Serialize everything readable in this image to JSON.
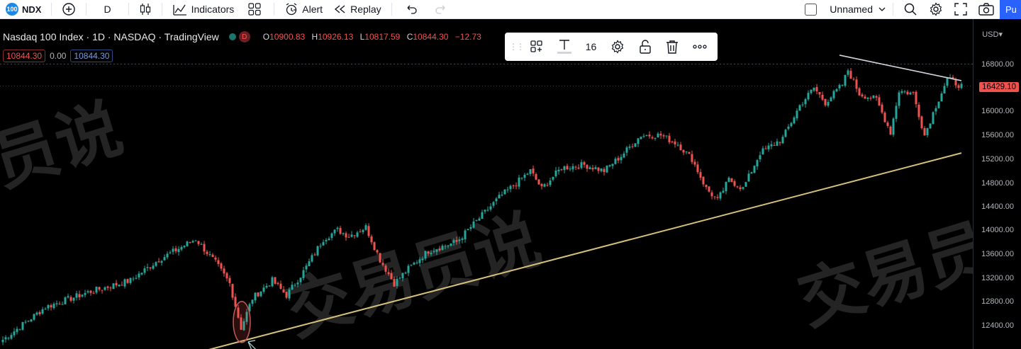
{
  "toolbar": {
    "symbol": "NDX",
    "symbol_logo": "100",
    "interval": "D",
    "indicators_label": "Indicators",
    "alert_label": "Alert",
    "replay_label": "Replay",
    "layout_name": "Unnamed",
    "publish_label": "Pu"
  },
  "legend": {
    "title": "Nasdaq 100 Index · 1D · NASDAQ · TradingView",
    "badge": "D",
    "ohlc": [
      {
        "key": "O",
        "value": "10900.83"
      },
      {
        "key": "H",
        "value": "10926.13"
      },
      {
        "key": "L",
        "value": "10817.59"
      },
      {
        "key": "C",
        "value": "10844.30"
      },
      {
        "key": "",
        "value": "−12.73"
      }
    ],
    "bid": "10844.30",
    "spread": "0.00",
    "ask": "10844.30"
  },
  "drawing_toolbar": {
    "font_size": "16"
  },
  "price_axis": {
    "currency": "USD",
    "ticks": [
      "16800.00",
      "16400.00",
      "16000.00",
      "15600.00",
      "15200.00",
      "14800.00",
      "14400.00",
      "14000.00",
      "13600.00",
      "13200.00",
      "12800.00",
      "12400.00"
    ],
    "last_price": "16429.10"
  },
  "watermark": {
    "text": "交易员说"
  },
  "colors": {
    "up": "#26a69a",
    "down": "#ef5350",
    "trendline": "#d4c07a",
    "accent": "#2962ff"
  },
  "chart_data": {
    "type": "candlestick",
    "symbol": "NDX",
    "interval": "1D",
    "ylim": [
      12000,
      17200
    ],
    "y_ticks": [
      12400,
      12800,
      13200,
      13600,
      14000,
      14400,
      14800,
      15200,
      15600,
      16000,
      16400,
      16800
    ],
    "path_keypoints": [
      {
        "i": 0,
        "price": 12150
      },
      {
        "i": 15,
        "price": 12700
      },
      {
        "i": 30,
        "price": 12950
      },
      {
        "i": 45,
        "price": 13150
      },
      {
        "i": 55,
        "price": 13500
      },
      {
        "i": 68,
        "price": 13850
      },
      {
        "i": 75,
        "price": 13450
      },
      {
        "i": 80,
        "price": 13100
      },
      {
        "i": 84,
        "price": 12350
      },
      {
        "i": 88,
        "price": 12850
      },
      {
        "i": 95,
        "price": 13150
      },
      {
        "i": 100,
        "price": 12900
      },
      {
        "i": 106,
        "price": 13300
      },
      {
        "i": 113,
        "price": 13850
      },
      {
        "i": 118,
        "price": 14000
      },
      {
        "i": 122,
        "price": 13900
      },
      {
        "i": 128,
        "price": 14050
      },
      {
        "i": 133,
        "price": 13500
      },
      {
        "i": 138,
        "price": 13100
      },
      {
        "i": 143,
        "price": 13350
      },
      {
        "i": 150,
        "price": 13650
      },
      {
        "i": 160,
        "price": 13800
      },
      {
        "i": 168,
        "price": 14200
      },
      {
        "i": 175,
        "price": 14550
      },
      {
        "i": 180,
        "price": 14750
      },
      {
        "i": 186,
        "price": 15000
      },
      {
        "i": 190,
        "price": 14700
      },
      {
        "i": 197,
        "price": 15050
      },
      {
        "i": 205,
        "price": 15100
      },
      {
        "i": 212,
        "price": 15000
      },
      {
        "i": 218,
        "price": 15250
      },
      {
        "i": 225,
        "price": 15600
      },
      {
        "i": 232,
        "price": 15600
      },
      {
        "i": 238,
        "price": 15450
      },
      {
        "i": 243,
        "price": 15200
      },
      {
        "i": 248,
        "price": 14700
      },
      {
        "i": 252,
        "price": 14500
      },
      {
        "i": 256,
        "price": 14850
      },
      {
        "i": 261,
        "price": 14700
      },
      {
        "i": 267,
        "price": 15300
      },
      {
        "i": 275,
        "price": 15550
      },
      {
        "i": 281,
        "price": 16100
      },
      {
        "i": 286,
        "price": 16400
      },
      {
        "i": 290,
        "price": 16150
      },
      {
        "i": 296,
        "price": 16450
      },
      {
        "i": 298,
        "price": 16700
      },
      {
        "i": 302,
        "price": 16300
      },
      {
        "i": 308,
        "price": 16200
      },
      {
        "i": 313,
        "price": 15650
      },
      {
        "i": 316,
        "price": 16350
      },
      {
        "i": 321,
        "price": 16300
      },
      {
        "i": 325,
        "price": 15600
      },
      {
        "i": 329,
        "price": 16100
      },
      {
        "i": 333,
        "price": 16550
      },
      {
        "i": 338,
        "price": 16429
      }
    ],
    "support_trendline": {
      "from": {
        "i": 70,
        "price": 11950
      },
      "to": {
        "i": 338,
        "price": 15300
      }
    },
    "resistance_trendline": {
      "from": {
        "i": 296,
        "price": 16950
      },
      "to": {
        "i": 338,
        "price": 16520
      }
    },
    "highlight": {
      "i": 84,
      "price": 12450
    },
    "last_close": 16429.1
  }
}
